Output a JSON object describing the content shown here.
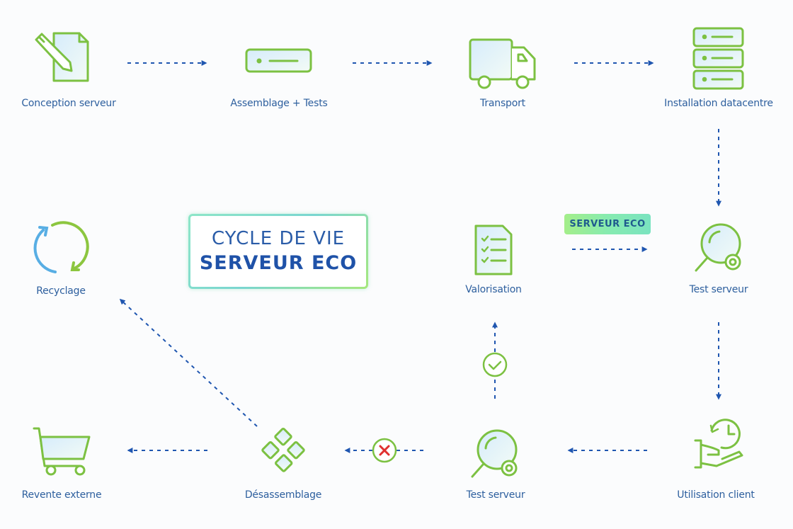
{
  "title": {
    "line1": "CYCLE DE VIE",
    "line2": "SERVEUR ECO"
  },
  "badge": "SERVEUR ECO",
  "colors": {
    "icon_stroke": "#7cc142",
    "icon_fill": "#e4f3fb",
    "arrow": "#1f56b0",
    "label": "#2d5f9e",
    "check": "#7cc142",
    "cross": "#e0302f",
    "recycle_blue": "#58aee4"
  },
  "nodes": [
    {
      "id": "conception",
      "label": "Conception serveur",
      "icon": "pencil-document-icon"
    },
    {
      "id": "assemblage",
      "label": "Assemblage + Tests",
      "icon": "server-unit-icon"
    },
    {
      "id": "transport",
      "label": "Transport",
      "icon": "truck-icon"
    },
    {
      "id": "installation",
      "label": "Installation datacentre",
      "icon": "server-rack-icon"
    },
    {
      "id": "test1",
      "label": "Test serveur",
      "icon": "magnifier-gear-icon"
    },
    {
      "id": "utilisation",
      "label": "Utilisation client",
      "icon": "hand-clock-icon"
    },
    {
      "id": "test2",
      "label": "Test serveur",
      "icon": "magnifier-gear-icon"
    },
    {
      "id": "valorisation",
      "label": "Valorisation",
      "icon": "checklist-icon"
    },
    {
      "id": "desassemblage",
      "label": "Désassemblage",
      "icon": "diamond-parts-icon"
    },
    {
      "id": "revente",
      "label": "Revente externe",
      "icon": "shopping-cart-icon"
    },
    {
      "id": "recyclage",
      "label": "Recyclage",
      "icon": "recycle-arrows-icon"
    }
  ],
  "edges": [
    {
      "from": "conception",
      "to": "assemblage"
    },
    {
      "from": "assemblage",
      "to": "transport"
    },
    {
      "from": "transport",
      "to": "installation"
    },
    {
      "from": "installation",
      "to": "test1"
    },
    {
      "from": "test1",
      "to": "utilisation"
    },
    {
      "from": "utilisation",
      "to": "test2"
    },
    {
      "from": "test2",
      "to": "valorisation",
      "marker": "check"
    },
    {
      "from": "test2",
      "to": "desassemblage",
      "marker": "cross"
    },
    {
      "from": "desassemblage",
      "to": "revente"
    },
    {
      "from": "desassemblage",
      "to": "recyclage"
    },
    {
      "from": "valorisation",
      "to": "test1",
      "label": "SERVEUR ECO"
    }
  ]
}
